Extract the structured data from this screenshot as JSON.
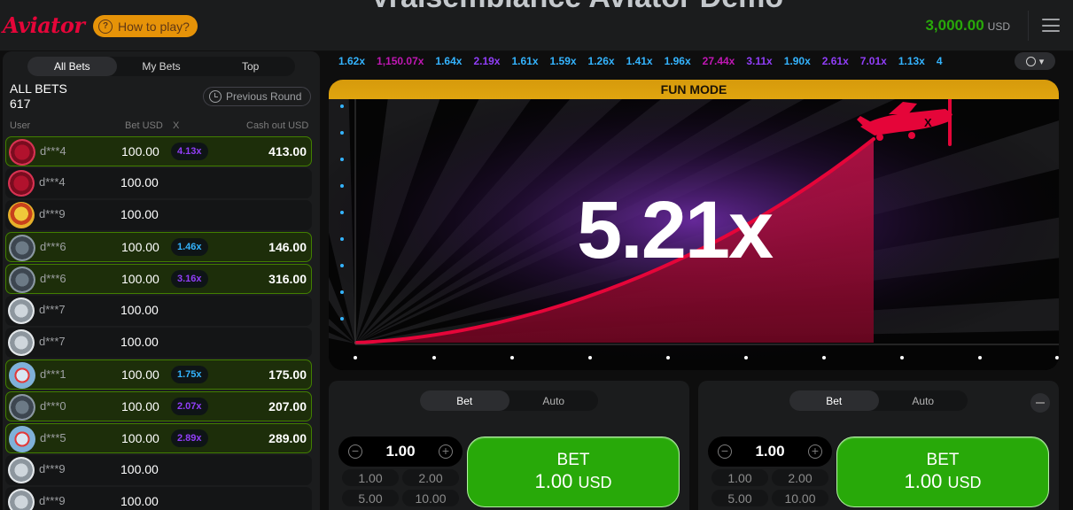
{
  "header": {
    "ghost_title": "Vraisemblance Aviator Demo",
    "logo": "Aviator",
    "how_to_play": "How to play?",
    "balance": "3,000.00",
    "currency": "USD"
  },
  "bets_panel": {
    "tabs": [
      "All Bets",
      "My Bets",
      "Top"
    ],
    "title": "ALL BETS",
    "count": "617",
    "previous_round": "Previous Round",
    "columns": {
      "user": "User",
      "bet": "Bet USD",
      "x": "X",
      "cashout": "Cash out USD"
    },
    "rows": [
      {
        "user": "d***4",
        "bet": "100.00",
        "mult": "4.13x",
        "cashout": "413.00",
        "win": true,
        "mult_color": "#913ef8",
        "avatar": "red"
      },
      {
        "user": "d***4",
        "bet": "100.00",
        "mult": "",
        "cashout": "",
        "win": false,
        "avatar": "red"
      },
      {
        "user": "d***9",
        "bet": "100.00",
        "mult": "",
        "cashout": "",
        "win": false,
        "avatar": "yellow"
      },
      {
        "user": "d***6",
        "bet": "100.00",
        "mult": "1.46x",
        "cashout": "146.00",
        "win": true,
        "mult_color": "#34b4ff",
        "avatar": "gray"
      },
      {
        "user": "d***6",
        "bet": "100.00",
        "mult": "3.16x",
        "cashout": "316.00",
        "win": true,
        "mult_color": "#913ef8",
        "avatar": "gray"
      },
      {
        "user": "d***7",
        "bet": "100.00",
        "mult": "",
        "cashout": "",
        "win": false,
        "avatar": "light"
      },
      {
        "user": "d***7",
        "bet": "100.00",
        "mult": "",
        "cashout": "",
        "win": false,
        "avatar": "light"
      },
      {
        "user": "d***1",
        "bet": "100.00",
        "mult": "1.75x",
        "cashout": "175.00",
        "win": true,
        "mult_color": "#34b4ff",
        "avatar": "blue"
      },
      {
        "user": "d***0",
        "bet": "100.00",
        "mult": "2.07x",
        "cashout": "207.00",
        "win": true,
        "mult_color": "#913ef8",
        "avatar": "gray"
      },
      {
        "user": "d***5",
        "bet": "100.00",
        "mult": "2.89x",
        "cashout": "289.00",
        "win": true,
        "mult_color": "#913ef8",
        "avatar": "blue"
      },
      {
        "user": "d***9",
        "bet": "100.00",
        "mult": "",
        "cashout": "",
        "win": false,
        "avatar": "light"
      },
      {
        "user": "d***9",
        "bet": "100.00",
        "mult": "",
        "cashout": "",
        "win": false,
        "avatar": "light"
      }
    ]
  },
  "history": [
    {
      "v": "1.62x",
      "c": "#34b4ff"
    },
    {
      "v": "1,150.07x",
      "c": "#c017b4"
    },
    {
      "v": "1.64x",
      "c": "#34b4ff"
    },
    {
      "v": "2.19x",
      "c": "#913ef8"
    },
    {
      "v": "1.61x",
      "c": "#34b4ff"
    },
    {
      "v": "1.59x",
      "c": "#34b4ff"
    },
    {
      "v": "1.26x",
      "c": "#34b4ff"
    },
    {
      "v": "1.41x",
      "c": "#34b4ff"
    },
    {
      "v": "1.96x",
      "c": "#34b4ff"
    },
    {
      "v": "27.44x",
      "c": "#c017b4"
    },
    {
      "v": "3.11x",
      "c": "#913ef8"
    },
    {
      "v": "1.90x",
      "c": "#34b4ff"
    },
    {
      "v": "2.61x",
      "c": "#913ef8"
    },
    {
      "v": "7.01x",
      "c": "#913ef8"
    },
    {
      "v": "1.13x",
      "c": "#34b4ff"
    },
    {
      "v": "4",
      "c": "#34b4ff"
    }
  ],
  "game": {
    "mode_banner": "FUN MODE",
    "multiplier": "5.21x"
  },
  "bet_panels": [
    {
      "tabs": [
        "Bet",
        "Auto"
      ],
      "amount": "1.00",
      "quick": [
        "1.00",
        "2.00",
        "5.00",
        "10.00"
      ],
      "button_label": "BET",
      "button_amount": "1.00",
      "button_currency": "USD"
    },
    {
      "tabs": [
        "Bet",
        "Auto"
      ],
      "amount": "1.00",
      "quick": [
        "1.00",
        "2.00",
        "5.00",
        "10.00"
      ],
      "button_label": "BET",
      "button_amount": "1.00",
      "button_currency": "USD"
    }
  ],
  "colors": {
    "win_green": "#28a909",
    "accent_red": "#e50539",
    "fun_mode": "#d69a0c"
  }
}
